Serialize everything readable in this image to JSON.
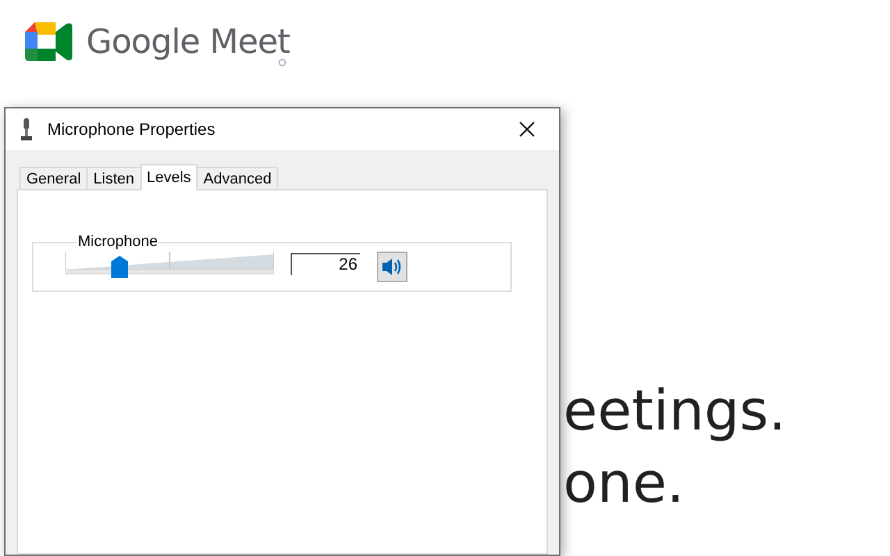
{
  "app": {
    "name": "Google Meet"
  },
  "headline": [
    "eetings.",
    "one."
  ],
  "dialog": {
    "title": "Microphone Properties",
    "tabs": [
      {
        "label": "General",
        "selected": false
      },
      {
        "label": "Listen",
        "selected": false
      },
      {
        "label": "Levels",
        "selected": true
      },
      {
        "label": "Advanced",
        "selected": false
      }
    ],
    "group_label": "Microphone",
    "slider": {
      "level": 0.26
    },
    "value": "26",
    "muted": false
  }
}
